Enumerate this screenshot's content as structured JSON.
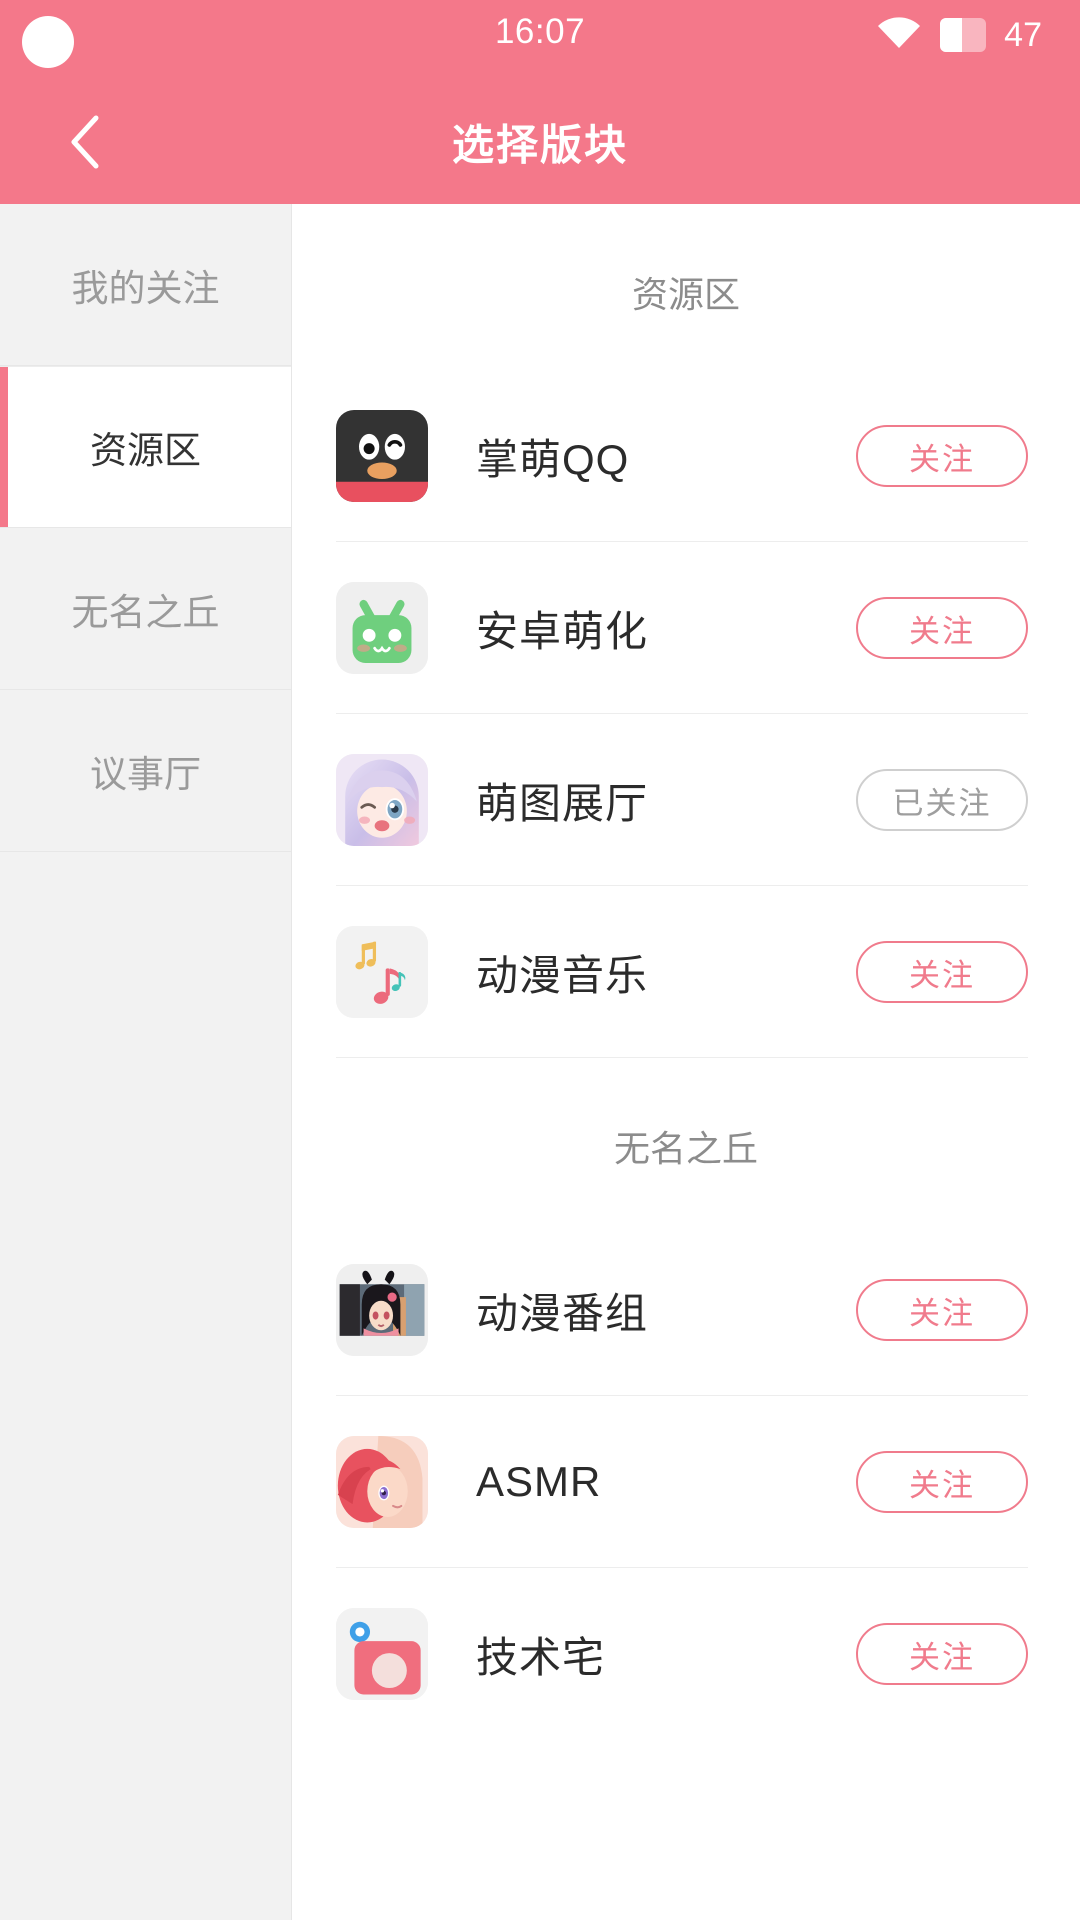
{
  "statusbar": {
    "time": "16:07",
    "battery_level": "47",
    "wifi_icon": "wifi-icon",
    "battery_icon": "battery-icon"
  },
  "header": {
    "title": "选择版块",
    "back_icon": "chevron-left-icon"
  },
  "sidebar": {
    "items": [
      {
        "label": "我的关注",
        "active": false
      },
      {
        "label": "资源区",
        "active": true
      },
      {
        "label": "无名之丘",
        "active": false
      },
      {
        "label": "议事厅",
        "active": false
      }
    ]
  },
  "main": {
    "sections": [
      {
        "title": "资源区",
        "rows": [
          {
            "name": "掌萌QQ",
            "avatar": "qq-penguin-icon",
            "button": "关注",
            "followed": false
          },
          {
            "name": "安卓萌化",
            "avatar": "android-robot-icon",
            "button": "关注",
            "followed": false
          },
          {
            "name": "萌图展厅",
            "avatar": "anime-girl-icon",
            "button": "已关注",
            "followed": true
          },
          {
            "name": "动漫音乐",
            "avatar": "music-notes-icon",
            "button": "关注",
            "followed": false
          }
        ]
      },
      {
        "title": "无名之丘",
        "rows": [
          {
            "name": "动漫番组",
            "avatar": "anime-tv-icon",
            "button": "关注",
            "followed": false
          },
          {
            "name": "ASMR",
            "avatar": "red-hair-girl-icon",
            "button": "关注",
            "followed": false
          },
          {
            "name": "技术宅",
            "avatar": "camera-icon",
            "button": "关注",
            "followed": false
          }
        ]
      }
    ]
  },
  "colors": {
    "accent": "#F4788A",
    "button_border": "#F07B8C",
    "followed_border": "#CFCFCF"
  }
}
